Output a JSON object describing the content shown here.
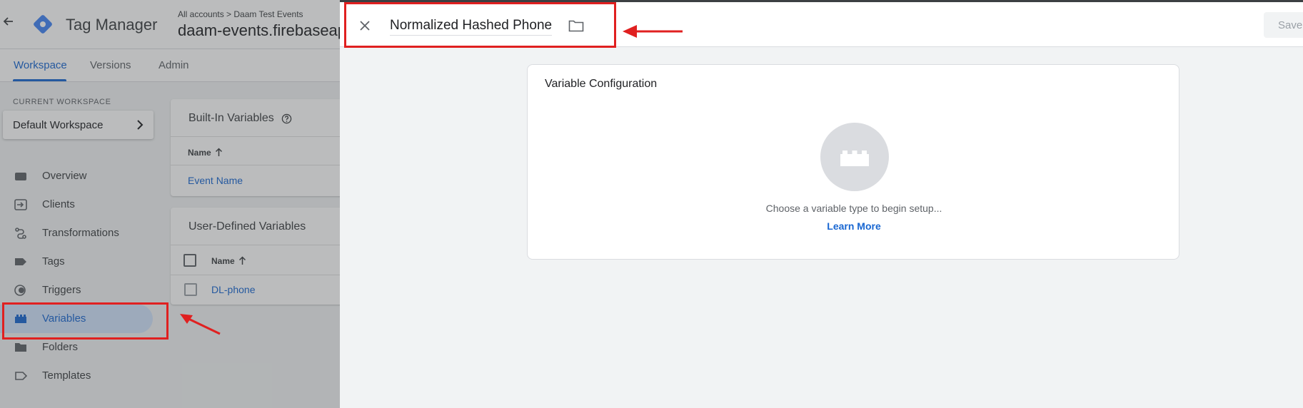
{
  "app": {
    "title": "Tag Manager",
    "breadcrumb": "All accounts > Daam Test Events",
    "container_name": "daam-events.firebaseapp.com",
    "tabs": [
      {
        "label": "Workspace",
        "active": true
      },
      {
        "label": "Versions",
        "active": false
      },
      {
        "label": "Admin",
        "active": false
      }
    ],
    "current_workspace_label": "CURRENT WORKSPACE",
    "workspace_name": "Default Workspace"
  },
  "sidebar": {
    "items": [
      {
        "label": "Overview",
        "icon": "overview-icon"
      },
      {
        "label": "Clients",
        "icon": "clients-icon"
      },
      {
        "label": "Transformations",
        "icon": "transformations-icon"
      },
      {
        "label": "Tags",
        "icon": "tag-icon"
      },
      {
        "label": "Triggers",
        "icon": "trigger-icon"
      },
      {
        "label": "Variables",
        "icon": "variables-icon",
        "active": true
      },
      {
        "label": "Folders",
        "icon": "folder-icon"
      },
      {
        "label": "Templates",
        "icon": "template-icon"
      }
    ]
  },
  "builtin_variables": {
    "title": "Built-In Variables",
    "column_name": "Name",
    "rows": [
      "Event Name"
    ]
  },
  "user_defined_variables": {
    "title": "User-Defined Variables",
    "column_name": "Name",
    "rows": [
      "DL-phone"
    ]
  },
  "panel": {
    "variable_name": "Normalized Hashed Phone",
    "save_label": "Save",
    "config_title": "Variable Configuration",
    "config_hint": "Choose a variable type to begin setup...",
    "learn_more": "Learn More"
  },
  "colors": {
    "accent": "#1967d2",
    "annotation": "#e02020"
  }
}
